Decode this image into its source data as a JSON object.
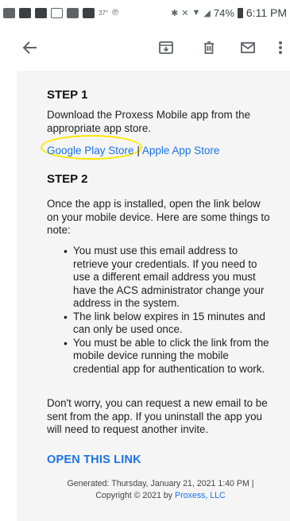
{
  "status_bar": {
    "temperature": "37°",
    "wifi_level": "74%",
    "time": "6:11 PM"
  },
  "toolbar": {
    "icons": [
      "back-arrow-icon",
      "archive-icon",
      "delete-icon",
      "mail-icon",
      "more-vert-icon"
    ]
  },
  "email": {
    "step1_heading": "STEP 1",
    "step1_text": "Download the Proxess Mobile app from the appropriate app store.",
    "google_play_link": "Google Play Store",
    "link_separator": " | ",
    "apple_link": "Apple App Store",
    "step2_heading": "STEP 2",
    "step2_text": "Once the app is installed, open the link below on your mobile device. Here are some things to note:",
    "notes": [
      "You must use this email address to retrieve your credentials. If you need to use a different email address you must have the ACS administrator change your address in the system.",
      "The link below expires in 15 minutes and can only be used once.",
      "You must be able to click the link from the mobile device running the mobile credential app for authentication to work."
    ],
    "closing_text": "Don't worry, you can request a new email to be sent from the app. If you uninstall the app you will need to request another invite.",
    "open_link_label": "OPEN THIS LINK",
    "footer_line1": "Generated: Thursday, January 21, 2021 1:40 PM |",
    "footer_copyright_prefix": "Copyright © 2021 by ",
    "footer_company": "Proxess, LLC"
  },
  "colors": {
    "link": "#1a73e8",
    "highlight": "#ffe600",
    "email_background": "#f5f5f5"
  }
}
